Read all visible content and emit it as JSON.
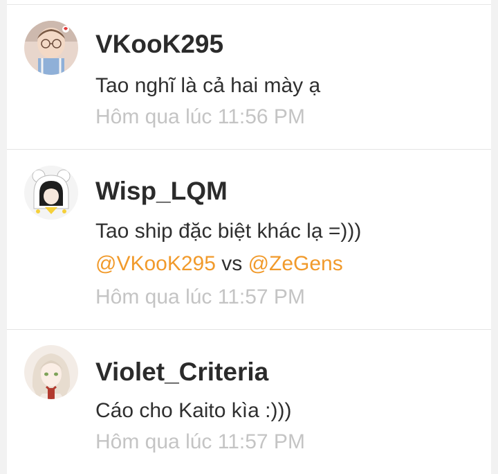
{
  "comments": [
    {
      "username": "VKooK295",
      "text": "Tao nghĩ là cả hai mày ạ",
      "time": "Hôm qua lúc 11:56 PM"
    },
    {
      "username": "Wisp_LQM",
      "text": "Tao ship đặc biệt khác lạ =)))",
      "mention_1": "@VKooK295",
      "mention_sep": " vs ",
      "mention_2": "@ZeGens",
      "time": "Hôm qua lúc 11:57 PM"
    },
    {
      "username": "Violet_Criteria",
      "text": "Cáo cho Kaito kìa :)))",
      "time": "Hôm qua lúc 11:57 PM"
    }
  ],
  "colors": {
    "mention": "#f19a2b",
    "timestamp": "#c4c4c4",
    "username": "#2b2b2b"
  }
}
